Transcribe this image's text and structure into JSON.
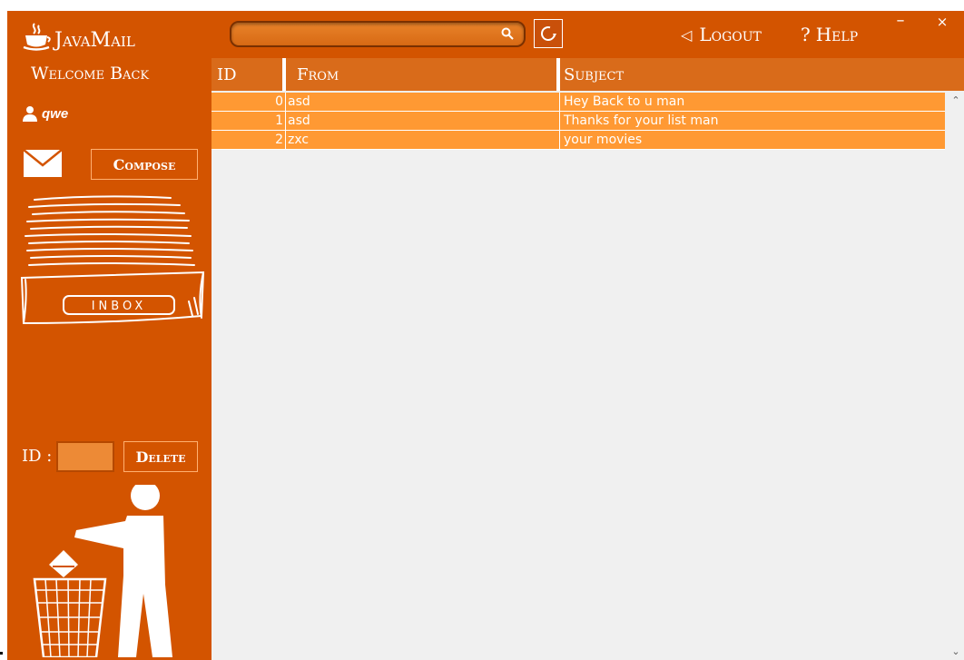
{
  "app": {
    "title": "JavaMail"
  },
  "search": {
    "value": "",
    "placeholder": ""
  },
  "header": {
    "logout_label": "Logout",
    "help_label": "Help"
  },
  "window_controls": {
    "minimize": "–",
    "close": "×"
  },
  "sidebar": {
    "welcome": "Welcome Back",
    "username": "qwe",
    "compose_label": "Compose",
    "id_label": "ID :",
    "id_value": "",
    "delete_label": "Delete",
    "inbox_art_label": "INBOX"
  },
  "table": {
    "columns": [
      "ID",
      "From",
      "Subject"
    ],
    "rows": [
      {
        "id": "0",
        "from": "asd",
        "subject": "Hey Back to u man"
      },
      {
        "id": "1",
        "from": "asd",
        "subject": "Thanks for your list man"
      },
      {
        "id": "2",
        "from": "zxc",
        "subject": "your movies"
      }
    ]
  },
  "colors": {
    "sidebar": "#d35400",
    "header": "#d96b1a",
    "row": "#ff9933",
    "background": "#f0f0f0"
  },
  "icons": [
    "java-cup-icon",
    "search-icon",
    "refresh-icon",
    "back-arrow-icon",
    "help-icon",
    "user-icon",
    "mail-icon",
    "inbox-tray-icon",
    "trash-person-icon"
  ]
}
